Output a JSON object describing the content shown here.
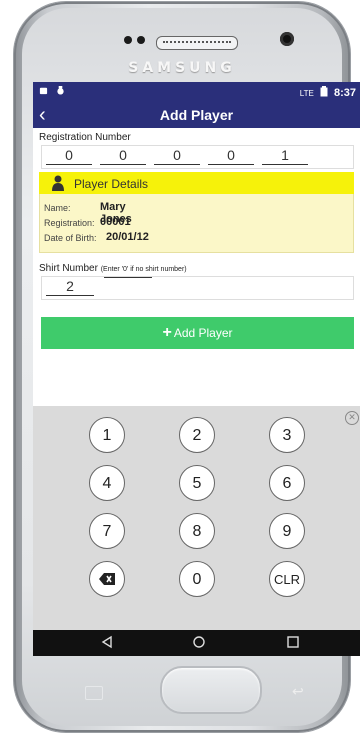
{
  "device": {
    "brand": "SAMSUNG"
  },
  "status_bar": {
    "network": "LTE",
    "time": "8:37"
  },
  "app_bar": {
    "title": "Add Player"
  },
  "registration": {
    "label": "Registration Number",
    "digits": [
      "0",
      "0",
      "0",
      "0",
      "1"
    ]
  },
  "player_details": {
    "header": "Player Details",
    "name_label": "Name:",
    "name_value": "Mary Jones",
    "reg_label": "Registration:",
    "reg_value": "00001",
    "dob_label": "Date of Birth:",
    "dob_value": "20/01/12"
  },
  "shirt": {
    "label": "Shirt Number",
    "hint": "(Enter '0' if no shirt number)",
    "digits": [
      "2",
      ""
    ]
  },
  "add_button": {
    "icon": "plus-icon",
    "label": "Add Player"
  },
  "keypad": {
    "keys": [
      "1",
      "2",
      "3",
      "4",
      "5",
      "6",
      "7",
      "8",
      "9",
      "0",
      "CLR"
    ],
    "backspace_icon": "backspace-icon",
    "close_icon": "close-icon"
  },
  "nav": {
    "back_icon": "back-triangle-icon",
    "home_icon": "home-circle-icon",
    "recent_icon": "recent-square-icon"
  }
}
